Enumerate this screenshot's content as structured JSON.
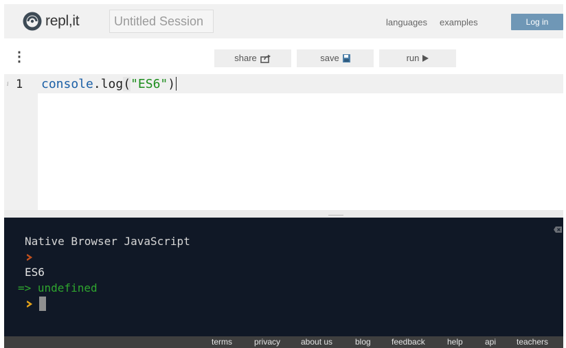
{
  "header": {
    "logo_text": "repl,it",
    "session_title": "Untitled Session",
    "nav": {
      "languages": "languages",
      "examples": "examples"
    },
    "login_label": "Log in"
  },
  "toolbar": {
    "share_label": "share",
    "save_label": "save",
    "run_label": "run"
  },
  "editor": {
    "line_number": "1",
    "line_info": "i",
    "code": {
      "object": "console",
      "dot": ".",
      "method": "log",
      "open_paren": "(",
      "string": "\"ES6\"",
      "close_paren": ")"
    }
  },
  "console": {
    "header": "Native Browser JavaScript",
    "output": "ES6",
    "result": "=> undefined"
  },
  "footer": {
    "links": [
      "terms",
      "privacy",
      "about us",
      "blog",
      "feedback",
      "help",
      "api",
      "teachers"
    ]
  },
  "colors": {
    "accent": "#6f97b6",
    "console_bg": "#101826",
    "result_green": "#2fa62f",
    "prompt_orange": "#e3a21a"
  }
}
